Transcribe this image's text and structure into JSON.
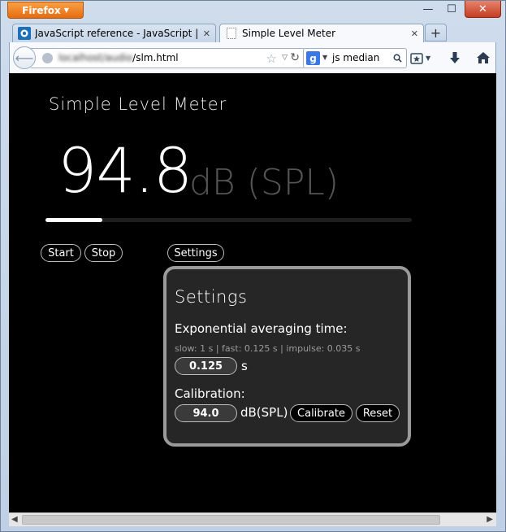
{
  "browser": {
    "app_button": "Firefox",
    "window_controls": {
      "minimize": "—",
      "maximize": "☐",
      "close": "✕"
    },
    "tabs": [
      {
        "label": "JavaScript reference - JavaScript | MDN",
        "active": false,
        "icon": "mdn-icon",
        "close": "✕"
      },
      {
        "label": "Simple Level Meter",
        "active": true,
        "icon": "blank-page-icon",
        "close": "✕"
      }
    ],
    "new_tab": "+",
    "url": {
      "host": "localhost/audio",
      "path": "/slm.html"
    },
    "search": {
      "engine_icon": "g",
      "query": "js median"
    }
  },
  "page": {
    "title": "Simple Level Meter",
    "level": {
      "value": "94.8",
      "unit": "dB (SPL)",
      "meter_fill_fraction": 0.155
    },
    "buttons": {
      "start": "Start",
      "stop": "Stop",
      "settings": "Settings"
    },
    "settings": {
      "heading": "Settings",
      "averaging": {
        "label": "Exponential averaging time:",
        "hint": "slow: 1 s | fast: 0.125 s | impulse: 0.035 s",
        "value": "0.125",
        "unit": "s"
      },
      "calibration": {
        "label": "Calibration:",
        "value": "94.0",
        "unit": "dB(SPL)",
        "calibrate_button": "Calibrate",
        "reset_button": "Reset"
      }
    }
  },
  "colors": {
    "firefox_orange": "#e66b10",
    "page_bg": "#000000",
    "panel_bg": "#262626",
    "panel_border": "#9a9a9a",
    "unit_gray": "#555555"
  }
}
